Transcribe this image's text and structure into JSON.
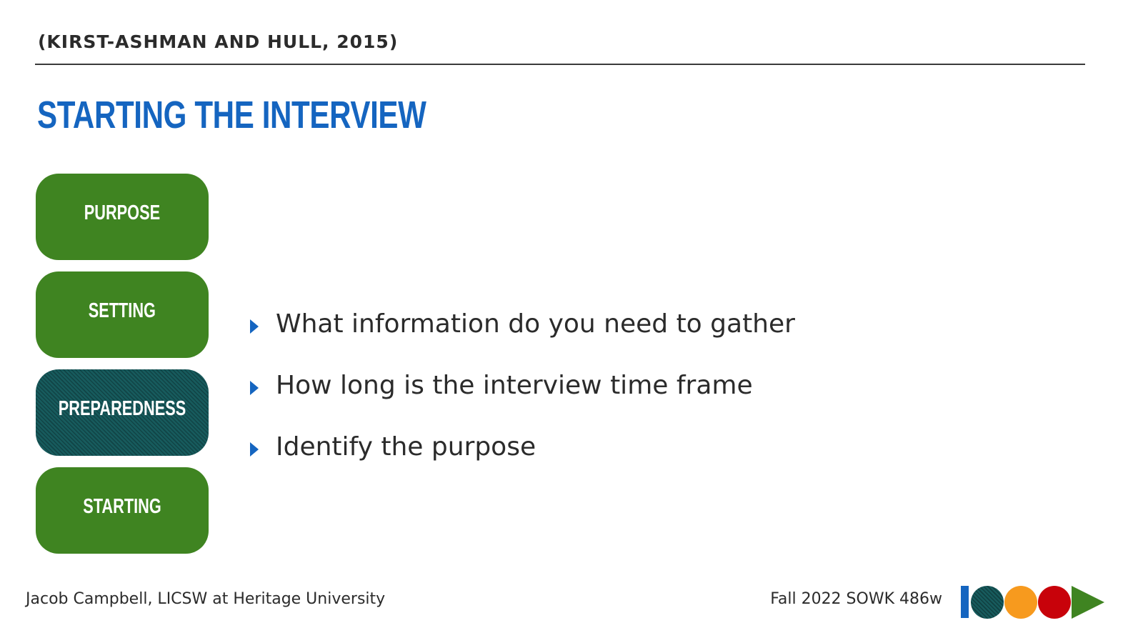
{
  "header": {
    "citation": "(KIRST-ASHMAN AND HULL, 2015)",
    "title": "STARTING THE INTERVIEW"
  },
  "steps": [
    {
      "label": "PURPOSE",
      "active": false
    },
    {
      "label": "SETTING",
      "active": false
    },
    {
      "label": "PREPAREDNESS",
      "active": true
    },
    {
      "label": "STARTING",
      "active": false
    }
  ],
  "bullets": [
    "What information do you need to gather",
    "How long is the interview time frame",
    "Identify the purpose"
  ],
  "footer": {
    "author": "Jacob Campbell, LICSW at Heritage University",
    "course": "Fall 2022 SOWK 486w"
  },
  "colors": {
    "title_blue": "#1565c0",
    "step_green": "#3f8421",
    "step_active_teal": "#175b5d",
    "logo_orange": "#f79a1e",
    "logo_red": "#c8020a"
  }
}
